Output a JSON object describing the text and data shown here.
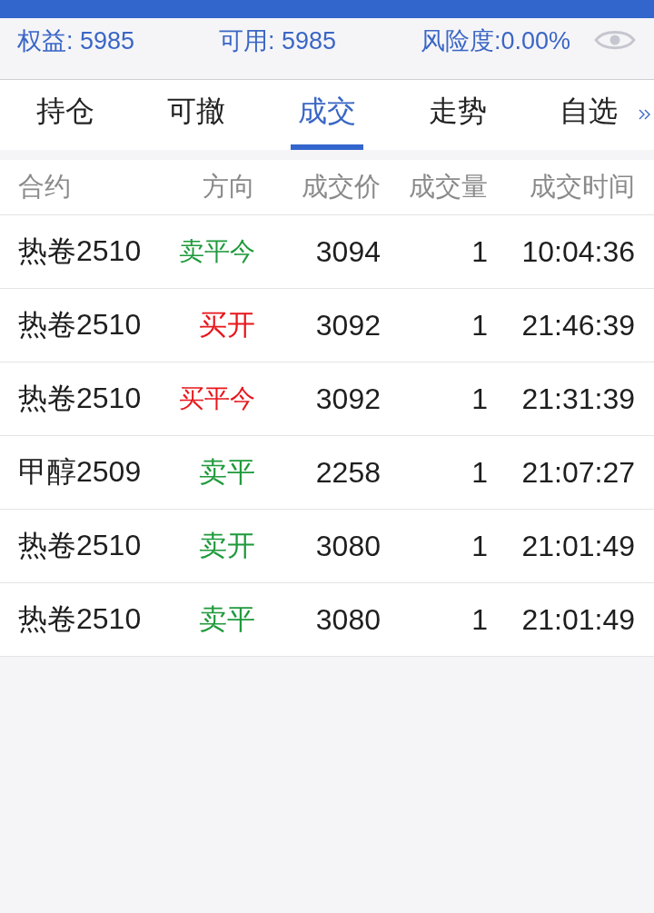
{
  "summary": [
    "权益: 5985",
    "可用: 5985",
    "风险度:0.00%"
  ],
  "tabs": [
    {
      "label": "持仓",
      "selected": false
    },
    {
      "label": "可撤",
      "selected": false
    },
    {
      "label": "成交",
      "selected": true
    },
    {
      "label": "走势",
      "selected": false
    },
    {
      "label": "自选",
      "selected": false
    }
  ],
  "table": {
    "columns": [
      "合约",
      "方向",
      "成交价",
      "成交量",
      "成交时间"
    ],
    "rows": [
      {
        "contract": "热卷2510",
        "direction": "卖平今",
        "color": "#1f9a3c",
        "price": "3094",
        "volume": "1",
        "time": "10:04:36"
      },
      {
        "contract": "热卷2510",
        "direction": "买开",
        "color": "#e8161b",
        "price": "3092",
        "volume": "1",
        "time": "21:46:39"
      },
      {
        "contract": "热卷2510",
        "direction": "买平今",
        "color": "#e8161b",
        "price": "3092",
        "volume": "1",
        "time": "21:31:39"
      },
      {
        "contract": "甲醇2509",
        "direction": "卖平",
        "color": "#1f9a3c",
        "price": "2258",
        "volume": "1",
        "time": "21:07:27"
      },
      {
        "contract": "热卷2510",
        "direction": "卖开",
        "color": "#1f9a3c",
        "price": "3080",
        "volume": "1",
        "time": "21:01:49"
      },
      {
        "contract": "热卷2510",
        "direction": "卖平",
        "color": "#1f9a3c",
        "price": "3080",
        "volume": "1",
        "time": "21:01:49"
      }
    ]
  }
}
